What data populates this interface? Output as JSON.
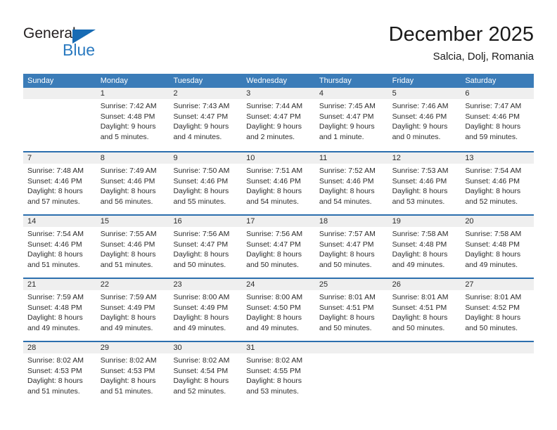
{
  "brand": {
    "name_top": "General",
    "name_bottom": "Blue",
    "color_dark": "#231f20",
    "color_blue": "#2a7ac0",
    "triangle_color": "#176bb4",
    "triangle_icon": "triangle-icon"
  },
  "header": {
    "title": "December 2025",
    "subtitle": "Salcia, Dolj, Romania"
  },
  "theme": {
    "header_row_bg": "#3b7cb8",
    "header_row_text": "#ffffff",
    "week_divider": "#2c6fae",
    "daynum_band_bg": "#efefef",
    "body_text": "#2b2b2b"
  },
  "weekdays": [
    "Sunday",
    "Monday",
    "Tuesday",
    "Wednesday",
    "Thursday",
    "Friday",
    "Saturday"
  ],
  "weeks": [
    [
      {
        "day": "",
        "sunrise": "",
        "sunset": "",
        "daylight_line1": "",
        "daylight_line2": "",
        "empty": true
      },
      {
        "day": "1",
        "sunrise": "Sunrise: 7:42 AM",
        "sunset": "Sunset: 4:48 PM",
        "daylight_line1": "Daylight: 9 hours",
        "daylight_line2": "and 5 minutes.",
        "empty": false
      },
      {
        "day": "2",
        "sunrise": "Sunrise: 7:43 AM",
        "sunset": "Sunset: 4:47 PM",
        "daylight_line1": "Daylight: 9 hours",
        "daylight_line2": "and 4 minutes.",
        "empty": false
      },
      {
        "day": "3",
        "sunrise": "Sunrise: 7:44 AM",
        "sunset": "Sunset: 4:47 PM",
        "daylight_line1": "Daylight: 9 hours",
        "daylight_line2": "and 2 minutes.",
        "empty": false
      },
      {
        "day": "4",
        "sunrise": "Sunrise: 7:45 AM",
        "sunset": "Sunset: 4:47 PM",
        "daylight_line1": "Daylight: 9 hours",
        "daylight_line2": "and 1 minute.",
        "empty": false
      },
      {
        "day": "5",
        "sunrise": "Sunrise: 7:46 AM",
        "sunset": "Sunset: 4:46 PM",
        "daylight_line1": "Daylight: 9 hours",
        "daylight_line2": "and 0 minutes.",
        "empty": false
      },
      {
        "day": "6",
        "sunrise": "Sunrise: 7:47 AM",
        "sunset": "Sunset: 4:46 PM",
        "daylight_line1": "Daylight: 8 hours",
        "daylight_line2": "and 59 minutes.",
        "empty": false
      }
    ],
    [
      {
        "day": "7",
        "sunrise": "Sunrise: 7:48 AM",
        "sunset": "Sunset: 4:46 PM",
        "daylight_line1": "Daylight: 8 hours",
        "daylight_line2": "and 57 minutes.",
        "empty": false
      },
      {
        "day": "8",
        "sunrise": "Sunrise: 7:49 AM",
        "sunset": "Sunset: 4:46 PM",
        "daylight_line1": "Daylight: 8 hours",
        "daylight_line2": "and 56 minutes.",
        "empty": false
      },
      {
        "day": "9",
        "sunrise": "Sunrise: 7:50 AM",
        "sunset": "Sunset: 4:46 PM",
        "daylight_line1": "Daylight: 8 hours",
        "daylight_line2": "and 55 minutes.",
        "empty": false
      },
      {
        "day": "10",
        "sunrise": "Sunrise: 7:51 AM",
        "sunset": "Sunset: 4:46 PM",
        "daylight_line1": "Daylight: 8 hours",
        "daylight_line2": "and 54 minutes.",
        "empty": false
      },
      {
        "day": "11",
        "sunrise": "Sunrise: 7:52 AM",
        "sunset": "Sunset: 4:46 PM",
        "daylight_line1": "Daylight: 8 hours",
        "daylight_line2": "and 54 minutes.",
        "empty": false
      },
      {
        "day": "12",
        "sunrise": "Sunrise: 7:53 AM",
        "sunset": "Sunset: 4:46 PM",
        "daylight_line1": "Daylight: 8 hours",
        "daylight_line2": "and 53 minutes.",
        "empty": false
      },
      {
        "day": "13",
        "sunrise": "Sunrise: 7:54 AM",
        "sunset": "Sunset: 4:46 PM",
        "daylight_line1": "Daylight: 8 hours",
        "daylight_line2": "and 52 minutes.",
        "empty": false
      }
    ],
    [
      {
        "day": "14",
        "sunrise": "Sunrise: 7:54 AM",
        "sunset": "Sunset: 4:46 PM",
        "daylight_line1": "Daylight: 8 hours",
        "daylight_line2": "and 51 minutes.",
        "empty": false
      },
      {
        "day": "15",
        "sunrise": "Sunrise: 7:55 AM",
        "sunset": "Sunset: 4:46 PM",
        "daylight_line1": "Daylight: 8 hours",
        "daylight_line2": "and 51 minutes.",
        "empty": false
      },
      {
        "day": "16",
        "sunrise": "Sunrise: 7:56 AM",
        "sunset": "Sunset: 4:47 PM",
        "daylight_line1": "Daylight: 8 hours",
        "daylight_line2": "and 50 minutes.",
        "empty": false
      },
      {
        "day": "17",
        "sunrise": "Sunrise: 7:56 AM",
        "sunset": "Sunset: 4:47 PM",
        "daylight_line1": "Daylight: 8 hours",
        "daylight_line2": "and 50 minutes.",
        "empty": false
      },
      {
        "day": "18",
        "sunrise": "Sunrise: 7:57 AM",
        "sunset": "Sunset: 4:47 PM",
        "daylight_line1": "Daylight: 8 hours",
        "daylight_line2": "and 50 minutes.",
        "empty": false
      },
      {
        "day": "19",
        "sunrise": "Sunrise: 7:58 AM",
        "sunset": "Sunset: 4:48 PM",
        "daylight_line1": "Daylight: 8 hours",
        "daylight_line2": "and 49 minutes.",
        "empty": false
      },
      {
        "day": "20",
        "sunrise": "Sunrise: 7:58 AM",
        "sunset": "Sunset: 4:48 PM",
        "daylight_line1": "Daylight: 8 hours",
        "daylight_line2": "and 49 minutes.",
        "empty": false
      }
    ],
    [
      {
        "day": "21",
        "sunrise": "Sunrise: 7:59 AM",
        "sunset": "Sunset: 4:48 PM",
        "daylight_line1": "Daylight: 8 hours",
        "daylight_line2": "and 49 minutes.",
        "empty": false
      },
      {
        "day": "22",
        "sunrise": "Sunrise: 7:59 AM",
        "sunset": "Sunset: 4:49 PM",
        "daylight_line1": "Daylight: 8 hours",
        "daylight_line2": "and 49 minutes.",
        "empty": false
      },
      {
        "day": "23",
        "sunrise": "Sunrise: 8:00 AM",
        "sunset": "Sunset: 4:49 PM",
        "daylight_line1": "Daylight: 8 hours",
        "daylight_line2": "and 49 minutes.",
        "empty": false
      },
      {
        "day": "24",
        "sunrise": "Sunrise: 8:00 AM",
        "sunset": "Sunset: 4:50 PM",
        "daylight_line1": "Daylight: 8 hours",
        "daylight_line2": "and 49 minutes.",
        "empty": false
      },
      {
        "day": "25",
        "sunrise": "Sunrise: 8:01 AM",
        "sunset": "Sunset: 4:51 PM",
        "daylight_line1": "Daylight: 8 hours",
        "daylight_line2": "and 50 minutes.",
        "empty": false
      },
      {
        "day": "26",
        "sunrise": "Sunrise: 8:01 AM",
        "sunset": "Sunset: 4:51 PM",
        "daylight_line1": "Daylight: 8 hours",
        "daylight_line2": "and 50 minutes.",
        "empty": false
      },
      {
        "day": "27",
        "sunrise": "Sunrise: 8:01 AM",
        "sunset": "Sunset: 4:52 PM",
        "daylight_line1": "Daylight: 8 hours",
        "daylight_line2": "and 50 minutes.",
        "empty": false
      }
    ],
    [
      {
        "day": "28",
        "sunrise": "Sunrise: 8:02 AM",
        "sunset": "Sunset: 4:53 PM",
        "daylight_line1": "Daylight: 8 hours",
        "daylight_line2": "and 51 minutes.",
        "empty": false
      },
      {
        "day": "29",
        "sunrise": "Sunrise: 8:02 AM",
        "sunset": "Sunset: 4:53 PM",
        "daylight_line1": "Daylight: 8 hours",
        "daylight_line2": "and 51 minutes.",
        "empty": false
      },
      {
        "day": "30",
        "sunrise": "Sunrise: 8:02 AM",
        "sunset": "Sunset: 4:54 PM",
        "daylight_line1": "Daylight: 8 hours",
        "daylight_line2": "and 52 minutes.",
        "empty": false
      },
      {
        "day": "31",
        "sunrise": "Sunrise: 8:02 AM",
        "sunset": "Sunset: 4:55 PM",
        "daylight_line1": "Daylight: 8 hours",
        "daylight_line2": "and 53 minutes.",
        "empty": false
      },
      {
        "day": "",
        "sunrise": "",
        "sunset": "",
        "daylight_line1": "",
        "daylight_line2": "",
        "empty": true
      },
      {
        "day": "",
        "sunrise": "",
        "sunset": "",
        "daylight_line1": "",
        "daylight_line2": "",
        "empty": true
      },
      {
        "day": "",
        "sunrise": "",
        "sunset": "",
        "daylight_line1": "",
        "daylight_line2": "",
        "empty": true
      }
    ]
  ]
}
